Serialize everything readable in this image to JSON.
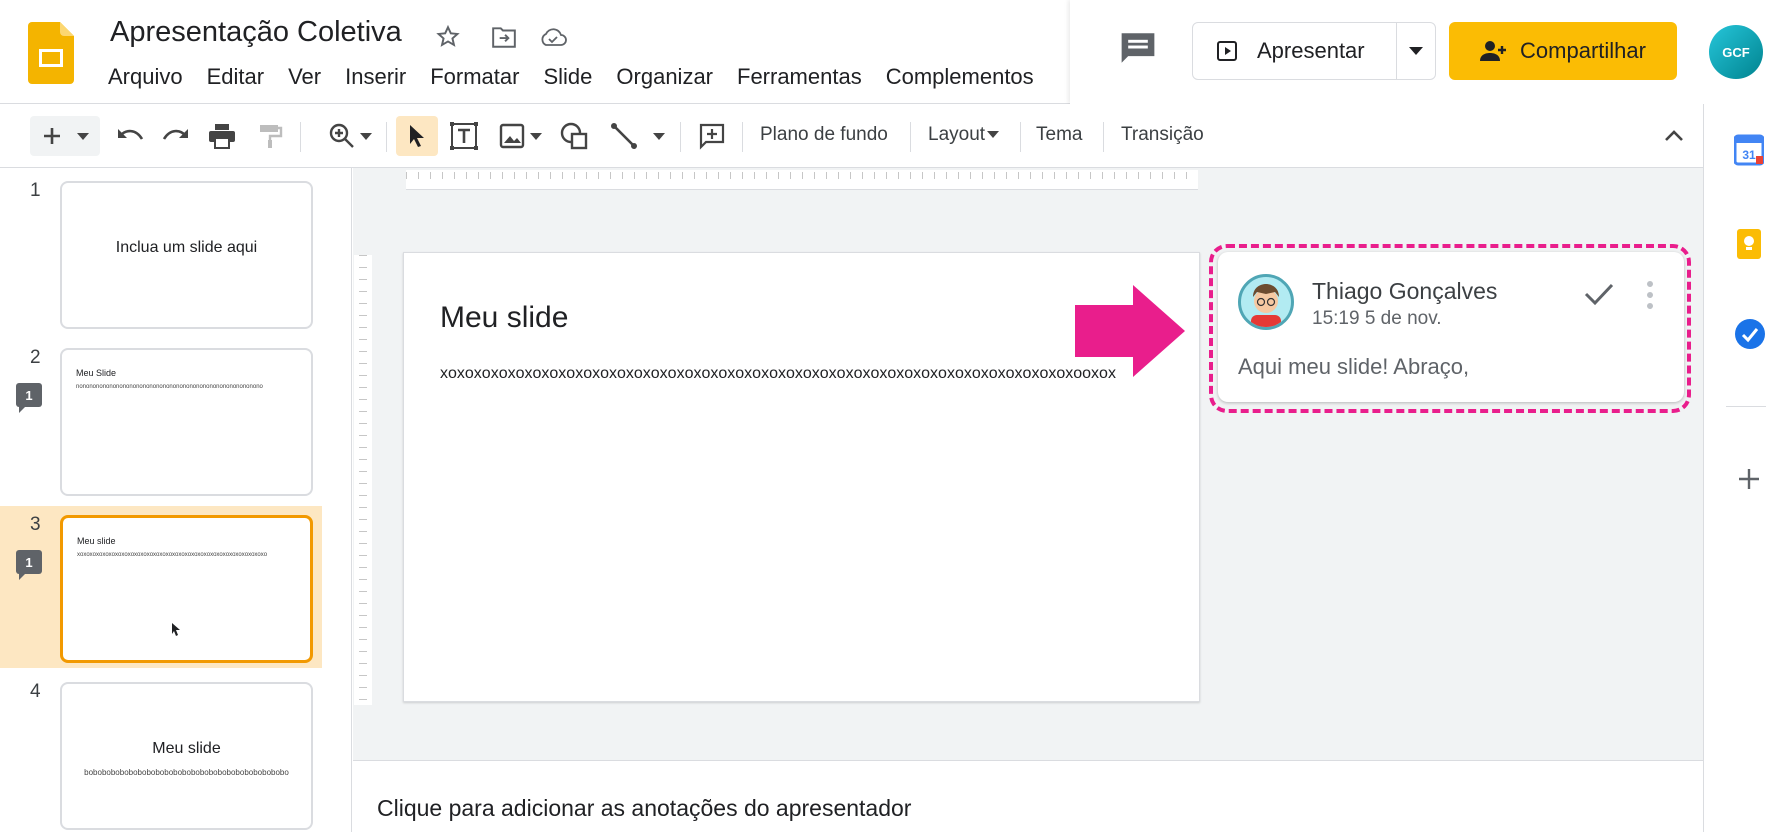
{
  "app": {
    "doc_title": "Apresentação Coletiva",
    "menu": [
      "Arquivo",
      "Editar",
      "Ver",
      "Inserir",
      "Formatar",
      "Slide",
      "Organizar",
      "Ferramentas",
      "Complementos"
    ],
    "present_label": "Apresentar",
    "share_label": "Compartilhar",
    "account_initials": "GCF"
  },
  "toolbar": {
    "background_label": "Plano de fundo",
    "layout_label": "Layout",
    "theme_label": "Tema",
    "transition_label": "Transição"
  },
  "slides": [
    {
      "num": "1",
      "text": "Inclua um slide aqui",
      "selected": false,
      "comment": false
    },
    {
      "num": "2",
      "title": "Meu Slide",
      "body": "nononononononononononononononononononononononononononono",
      "selected": false,
      "comment": true,
      "comment_count": "1"
    },
    {
      "num": "3",
      "title": "Meu slide",
      "body": "xoxoxoxoxoxoxoxoxoxoxoxoxoxoxoxoxoxoxoxoxoxoxoxoxoxoxoxoxoxo",
      "selected": true,
      "comment": true,
      "comment_count": "1"
    },
    {
      "num": "4",
      "title": "Meu slide",
      "body": "bobobobobobobobobobobobobobobobobobobobobobobo",
      "selected": false,
      "comment": false
    }
  ],
  "current_slide": {
    "title": "Meu slide",
    "body": "xoxoxoxoxoxoxoxoxoxoxoxoxoxoxoxoxoxoxoxoxoxoxoxoxoxoxoxoxoxoxoxoxoxoxoxoxoxooxox"
  },
  "comment": {
    "author": "Thiago Gonçalves",
    "time": "15:19 5 de nov.",
    "text": "Aqui meu slide! Abraço,"
  },
  "notes_placeholder": "Clique para adicionar as anotações do apresentador",
  "colors": {
    "accent": "#fbbc04",
    "highlight": "#e91e8c",
    "selected_slide": "#f29900"
  }
}
